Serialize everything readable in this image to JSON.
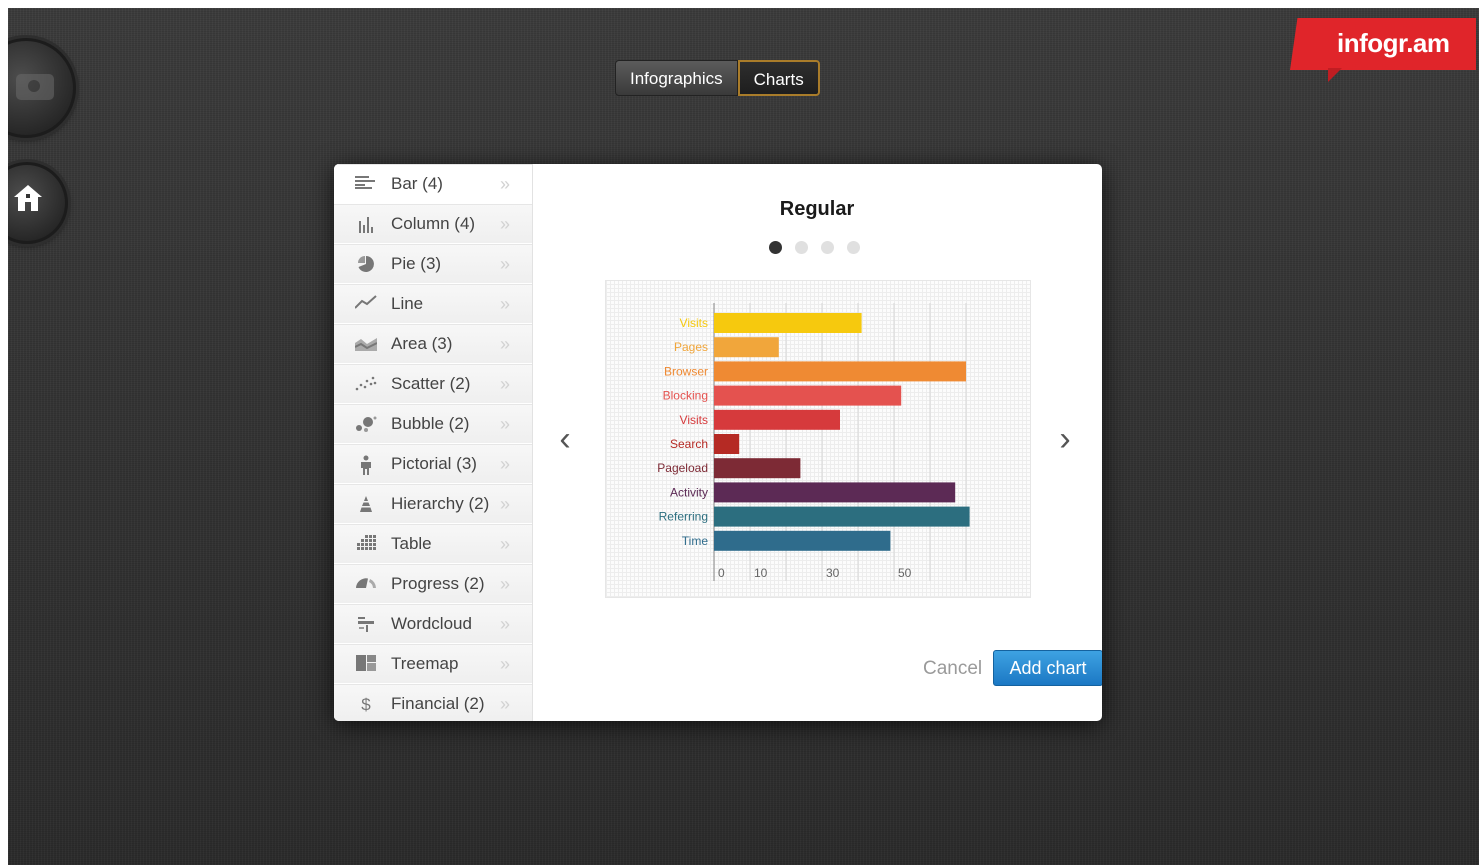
{
  "header": {
    "tabs": [
      {
        "label": "Infographics",
        "active": false
      },
      {
        "label": "Charts",
        "active": true
      }
    ],
    "brand": "infogr.am"
  },
  "sidebar": {
    "buttons": [
      {
        "icon": "camera-icon"
      },
      {
        "icon": "home-icon"
      }
    ]
  },
  "dialog": {
    "menu": [
      {
        "label": "Bar (4)",
        "icon": "bar-chart-icon",
        "selected": true
      },
      {
        "label": "Column (4)",
        "icon": "column-chart-icon"
      },
      {
        "label": "Pie (3)",
        "icon": "pie-chart-icon"
      },
      {
        "label": "Line",
        "icon": "line-chart-icon"
      },
      {
        "label": "Area (3)",
        "icon": "area-chart-icon"
      },
      {
        "label": "Scatter (2)",
        "icon": "scatter-chart-icon"
      },
      {
        "label": "Bubble (2)",
        "icon": "bubble-chart-icon"
      },
      {
        "label": "Pictorial (3)",
        "icon": "person-icon"
      },
      {
        "label": "Hierarchy (2)",
        "icon": "pyramid-icon"
      },
      {
        "label": "Table",
        "icon": "table-icon"
      },
      {
        "label": "Progress (2)",
        "icon": "gauge-icon"
      },
      {
        "label": "Wordcloud",
        "icon": "wordcloud-icon"
      },
      {
        "label": "Treemap",
        "icon": "treemap-icon"
      },
      {
        "label": "Financial (2)",
        "icon": "dollar-icon"
      }
    ],
    "preview_title": "Regular",
    "pager": {
      "count": 4,
      "active_index": 0
    },
    "cancel_label": "Cancel",
    "add_label": "Add chart"
  },
  "chart_data": {
    "type": "bar",
    "orientation": "horizontal",
    "categories": [
      "Visits",
      "Pages",
      "Browser",
      "Blocking",
      "Visits",
      "Search",
      "Pageload",
      "Activity",
      "Referring",
      "Time"
    ],
    "values": [
      41,
      18,
      70,
      52,
      35,
      7,
      24,
      67,
      71,
      49
    ],
    "colors": [
      "#f6c90e",
      "#f1a63b",
      "#ef8a33",
      "#e4524f",
      "#d63a3c",
      "#b52a24",
      "#7d2a35",
      "#5c2a55",
      "#2c6e7f",
      "#2f6c8c"
    ],
    "xticks": [
      "0",
      "10",
      "30",
      "50"
    ],
    "xlabel": "",
    "ylabel": "",
    "grid": true,
    "legend": "none"
  }
}
